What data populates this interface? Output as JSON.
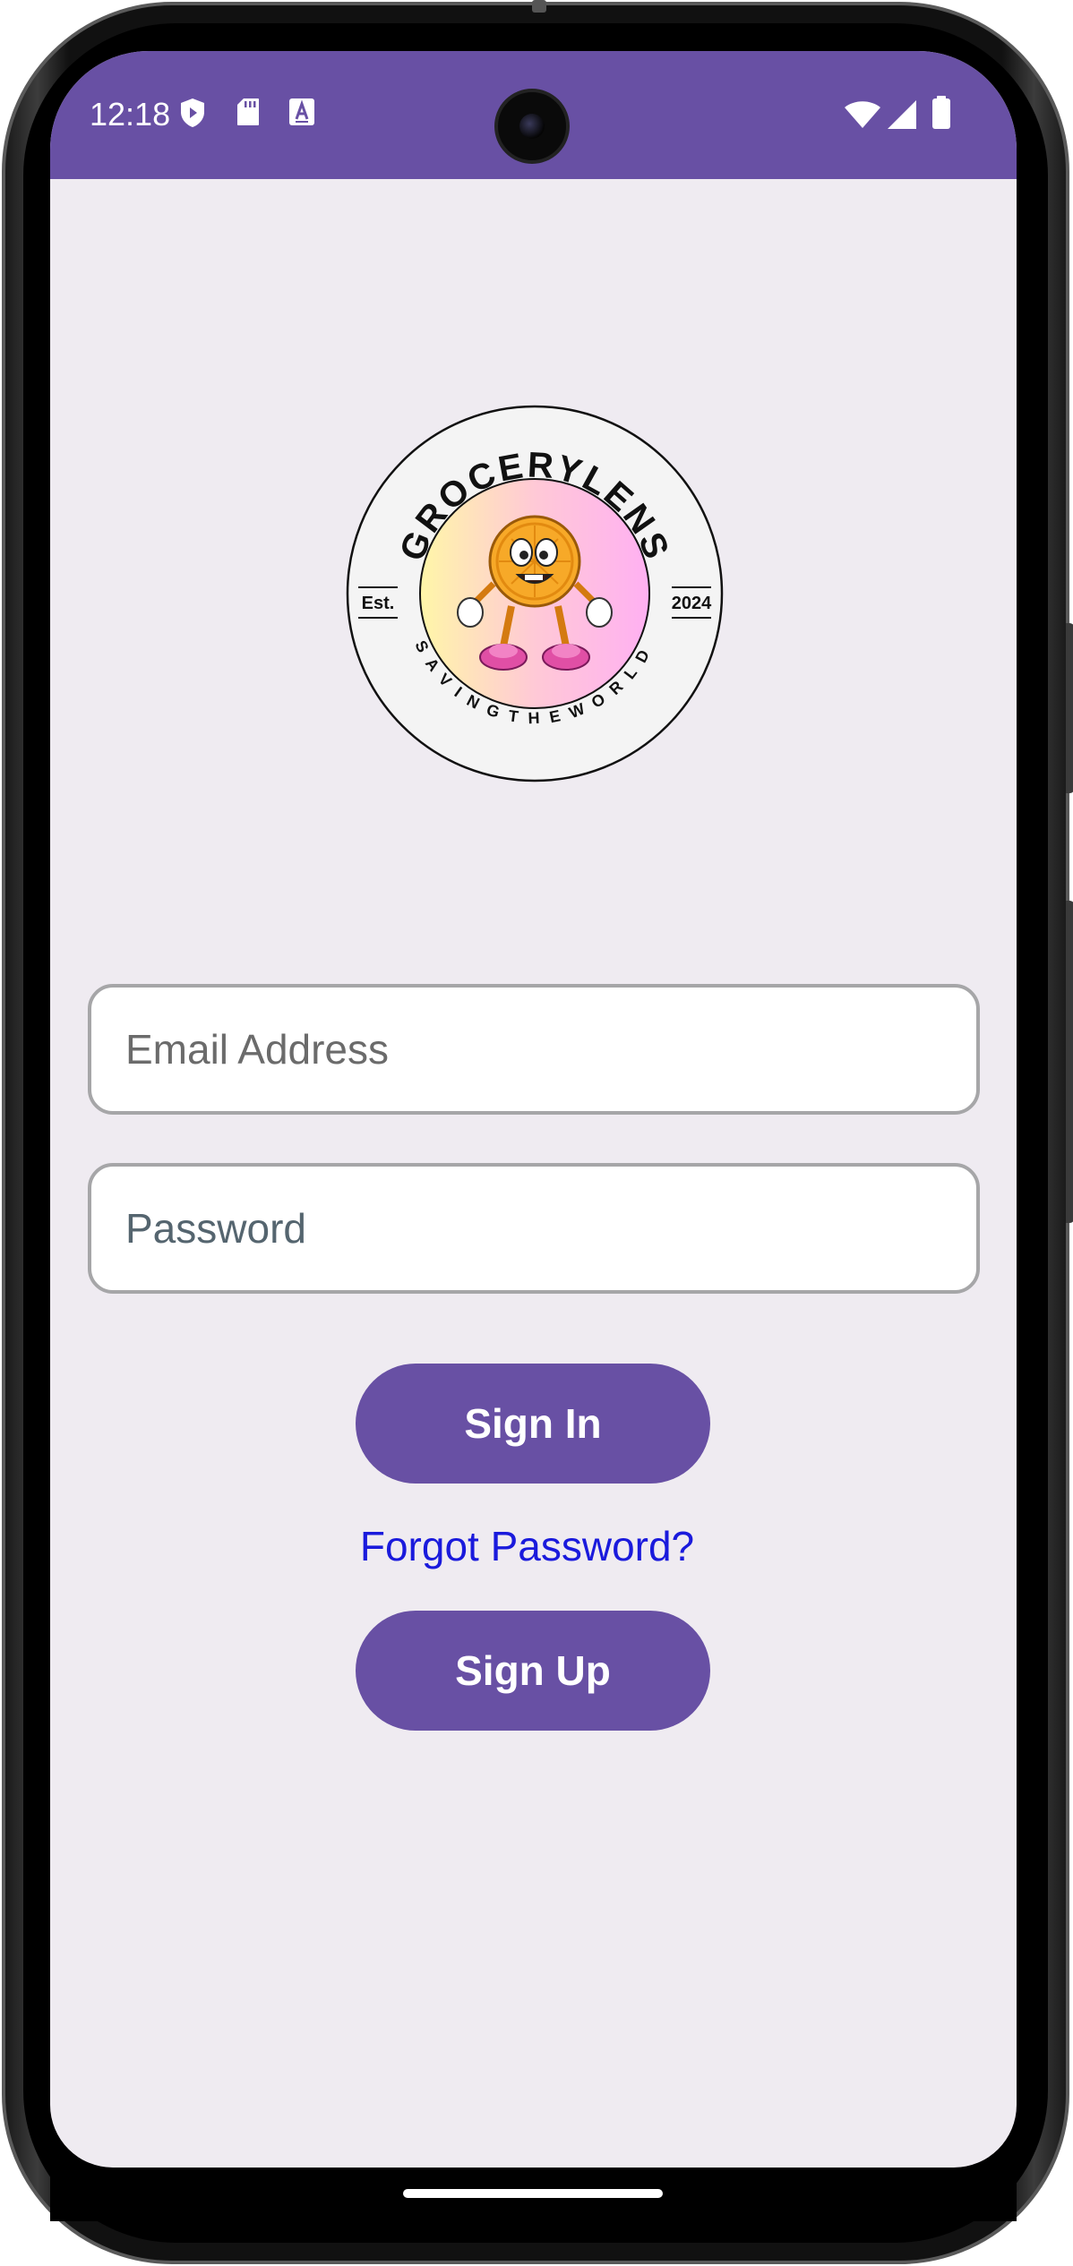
{
  "status_bar": {
    "time": "12:18",
    "left_icons": [
      "shield-icon",
      "sd-card-icon",
      "keyboard-a-icon"
    ],
    "right_icons": [
      "wifi-icon",
      "cell-signal-icon",
      "battery-icon"
    ],
    "color": "#6850a4"
  },
  "logo": {
    "top_text": "GROCERYLENS",
    "bottom_text": "SAVINGTHEWORLD",
    "left_text": "Est.",
    "right_text": "2024"
  },
  "form": {
    "email_placeholder": "Email Address",
    "password_placeholder": "Password"
  },
  "actions": {
    "sign_in_label": "Sign In",
    "forgot_password_label": "Forgot Password?",
    "sign_up_label": "Sign Up"
  },
  "colors": {
    "accent": "#6850a4",
    "background": "#efebf1",
    "link": "#1a1adc"
  }
}
